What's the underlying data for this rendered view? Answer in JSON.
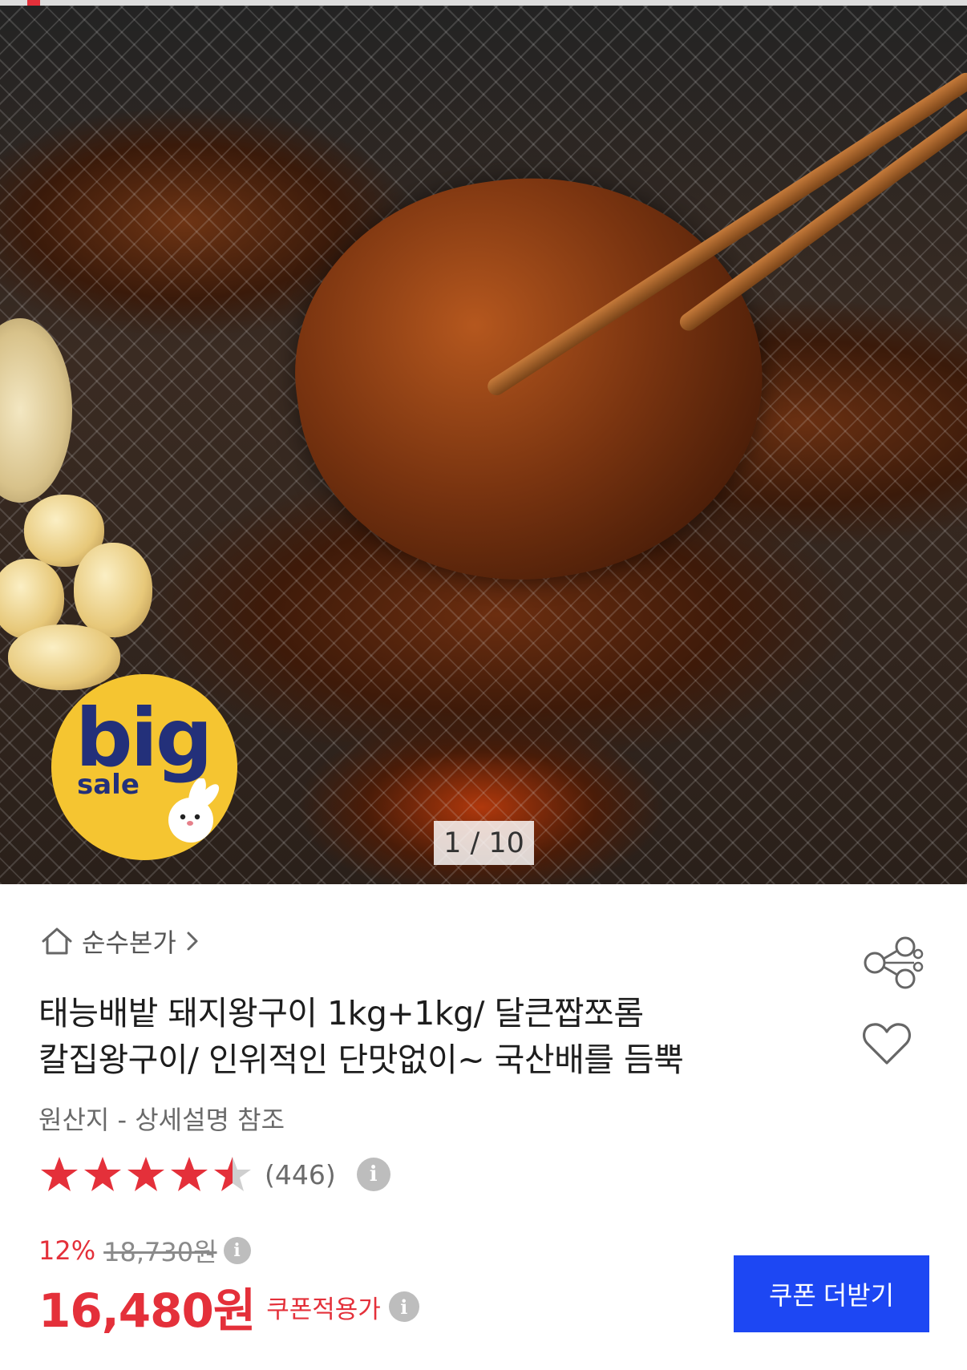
{
  "gallery": {
    "current": 1,
    "total": 10,
    "counter_text": "1 / 10",
    "badge": {
      "big": "big",
      "sale": "sale"
    }
  },
  "store": {
    "name": "순수본가",
    "icon": "home-icon"
  },
  "product": {
    "title_line1": "태능배밭 돼지왕구이 1kg+1kg/ 달큰짭쪼롬",
    "title_line2": "칼집왕구이/ 인위적인 단맛없이~ 국산배를 듬뿍",
    "origin": "원산지 - 상세설명 참조"
  },
  "rating": {
    "stars": 4.5,
    "max": 5,
    "count_text": "(446)"
  },
  "price": {
    "discount": "12%",
    "original": "18,730원",
    "final": "16,480원",
    "coupon_label": "쿠폰적용가"
  },
  "actions": {
    "coupon_button": "쿠폰 더받기"
  },
  "colors": {
    "accent_red": "#e4303a",
    "button_blue": "#1d47f3",
    "star_gray": "#cfcfcf"
  }
}
